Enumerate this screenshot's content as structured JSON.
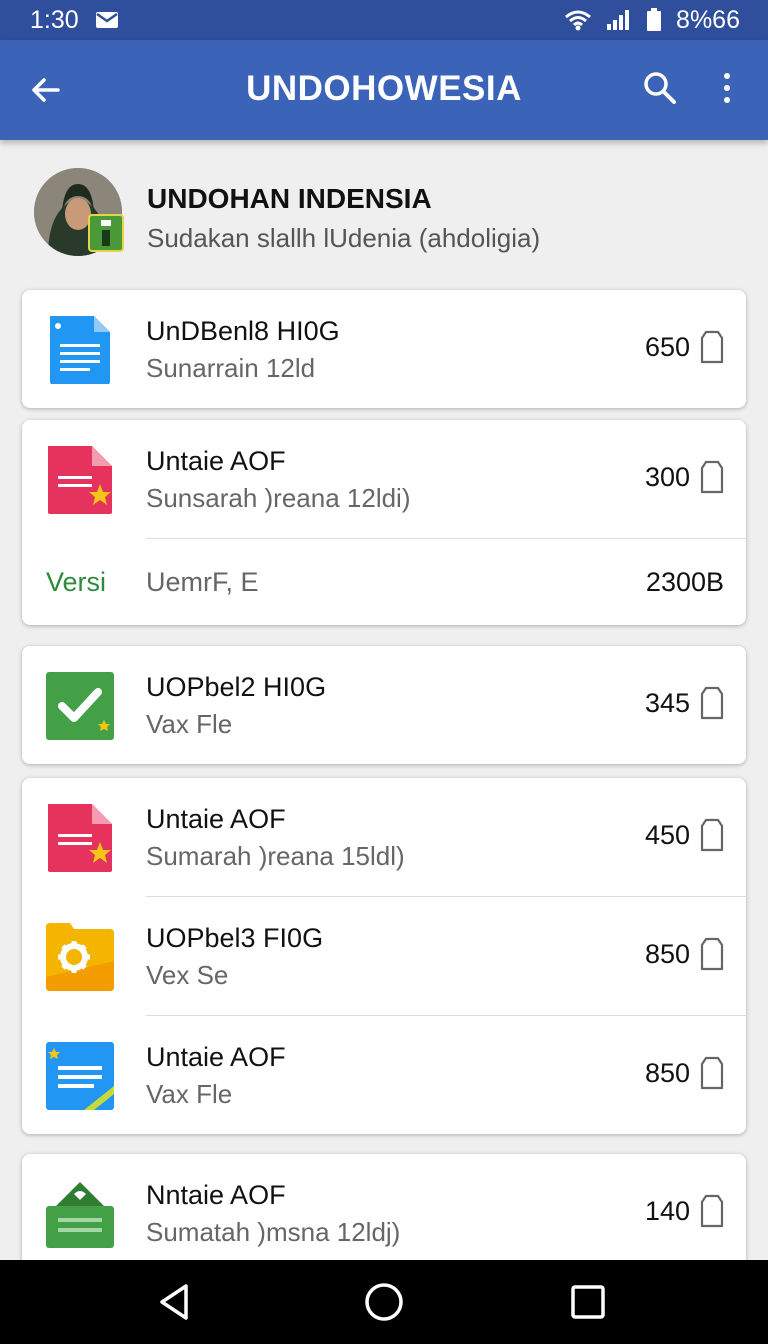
{
  "status_bar": {
    "time": "1:30",
    "battery_text": "8%66",
    "icons": [
      "mail-icon",
      "wifi-icon",
      "signal-icon",
      "battery-icon"
    ]
  },
  "app_bar": {
    "title": "UNDOHOWESIA",
    "icons": [
      "back-arrow-icon",
      "search-icon",
      "more-vert-icon"
    ]
  },
  "profile": {
    "name": "UNDOHAN INDENSIA",
    "subtitle": "Sudakan slallh lUdenia (ahdoligia)"
  },
  "cards": [
    {
      "rows": [
        {
          "icon": "doc-blue-icon",
          "title": "UnDBenl8 HI0G",
          "subtitle": "Sunarrain 12ld",
          "value": "650"
        }
      ]
    },
    {
      "rows": [
        {
          "icon": "doc-pink-star-icon",
          "title": "Untaie AOF",
          "subtitle": "Sunsarah )reana 12ldi)",
          "value": "300"
        }
      ],
      "version": {
        "label": "Versi",
        "text": "UemrF, E",
        "size": "2300B"
      }
    },
    {
      "rows": [
        {
          "icon": "check-green-icon",
          "title": "UOPbel2 HI0G",
          "subtitle": "Vax Fle",
          "value": "345"
        }
      ]
    },
    {
      "rows": [
        {
          "icon": "doc-pink-star-icon",
          "title": "Untaie AOF",
          "subtitle": "Sumarah )reana 15ldl)",
          "value": "450"
        },
        {
          "icon": "gear-yellow-icon",
          "title": "UOPbel3 FI0G",
          "subtitle": "Vex Se",
          "value": "850"
        },
        {
          "icon": "doc-blue-stripe-icon",
          "title": "Untaie AOF",
          "subtitle": "Vax Fle",
          "value": "850"
        }
      ]
    },
    {
      "rows": [
        {
          "icon": "box-green-icon",
          "title": "Nntaie AOF",
          "subtitle": "Sumatah )msna 12ldj)",
          "value": "140"
        }
      ]
    }
  ],
  "nav_bar": {
    "icons": [
      "nav-back-icon",
      "nav-home-icon",
      "nav-recents-icon"
    ]
  },
  "colors": {
    "status_bar": "#2f4f9c",
    "app_bar": "#3b63b8",
    "background": "#efefef",
    "accent_green": "#2e8b3c"
  }
}
